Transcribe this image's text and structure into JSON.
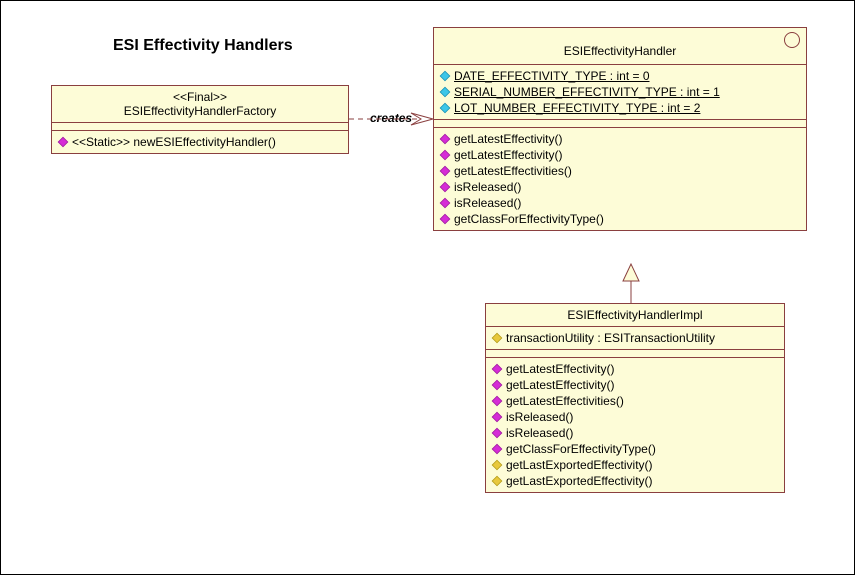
{
  "diagram": {
    "title": "ESI Effectivity Handlers",
    "relation_label": "creates"
  },
  "factory": {
    "stereotype": "<<Final>>",
    "name": "ESIEffectivityHandlerFactory",
    "methods": [
      {
        "label": "<<Static>> newESIEffectivityHandler()",
        "icon": "method"
      }
    ]
  },
  "handler": {
    "name": "ESIEffectivityHandler",
    "attributes": [
      {
        "label": "DATE_EFFECTIVITY_TYPE : int = 0",
        "icon": "attr-cyan",
        "underline": true
      },
      {
        "label": "SERIAL_NUMBER_EFFECTIVITY_TYPE : int = 1",
        "icon": "attr-cyan",
        "underline": true
      },
      {
        "label": "LOT_NUMBER_EFFECTIVITY_TYPE : int = 2",
        "icon": "attr-cyan",
        "underline": true
      }
    ],
    "methods": [
      {
        "label": "getLatestEffectivity()",
        "icon": "method"
      },
      {
        "label": "getLatestEffectivity()",
        "icon": "method"
      },
      {
        "label": "getLatestEffectivities()",
        "icon": "method"
      },
      {
        "label": "isReleased()",
        "icon": "method"
      },
      {
        "label": "isReleased()",
        "icon": "method"
      },
      {
        "label": "getClassForEffectivityType()",
        "icon": "method"
      }
    ]
  },
  "impl": {
    "name": "ESIEffectivityHandlerImpl",
    "attributes": [
      {
        "label": "transactionUtility : ESITransactionUtility",
        "icon": "key"
      }
    ],
    "methods": [
      {
        "label": "getLatestEffectivity()",
        "icon": "method"
      },
      {
        "label": "getLatestEffectivity()",
        "icon": "method"
      },
      {
        "label": "getLatestEffectivities()",
        "icon": "method"
      },
      {
        "label": "isReleased()",
        "icon": "method"
      },
      {
        "label": "isReleased()",
        "icon": "method"
      },
      {
        "label": "getClassForEffectivityType()",
        "icon": "method"
      },
      {
        "label": "getLastExportedEffectivity()",
        "icon": "key"
      },
      {
        "label": "getLastExportedEffectivity()",
        "icon": "key"
      }
    ]
  }
}
